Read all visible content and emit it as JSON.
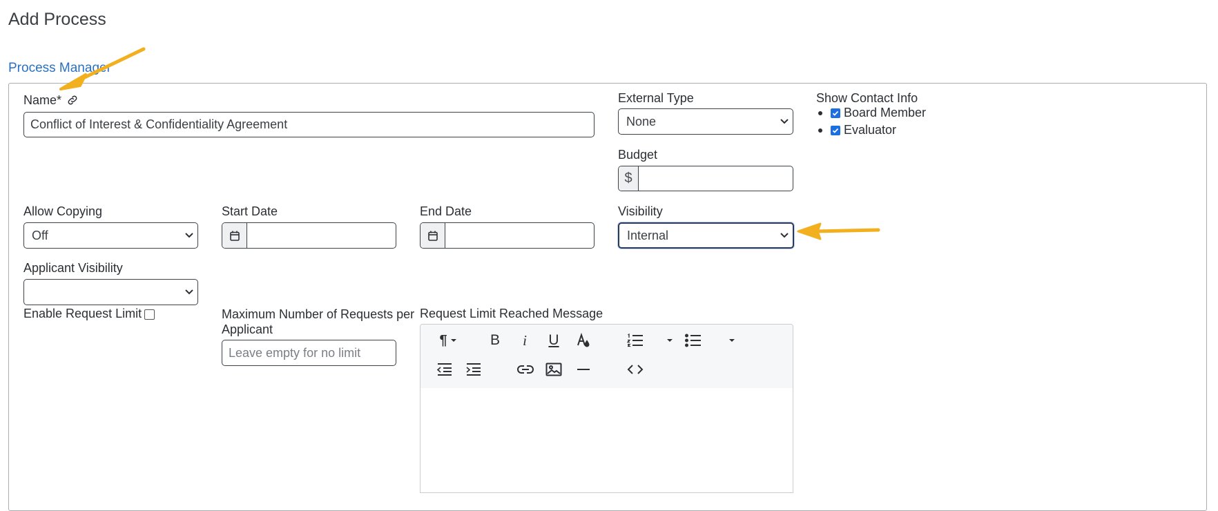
{
  "page": {
    "title": "Add Process"
  },
  "section": {
    "title": "Process Manager"
  },
  "form": {
    "name": {
      "label": "Name*",
      "value": "Conflict of Interest & Confidentiality Agreement"
    },
    "external_type": {
      "label": "External Type",
      "value": "None"
    },
    "contact": {
      "label": "Show Contact Info",
      "options": [
        {
          "label": "Board Member",
          "checked": true
        },
        {
          "label": "Evaluator",
          "checked": true
        }
      ]
    },
    "budget": {
      "label": "Budget",
      "prefix": "$",
      "value": ""
    },
    "allow_copying": {
      "label": "Allow Copying",
      "value": "Off"
    },
    "start_date": {
      "label": "Start Date",
      "value": ""
    },
    "end_date": {
      "label": "End Date",
      "value": ""
    },
    "visibility": {
      "label": "Visibility",
      "value": "Internal"
    },
    "applicant_visibility": {
      "label": "Applicant Visibility",
      "value": ""
    },
    "request_limit": {
      "label": "Enable Request Limit",
      "checked": false
    },
    "max_requests": {
      "label_line1": "Maximum Number of Requests per",
      "label_line2": "Applicant",
      "placeholder": "Leave empty for no limit"
    },
    "limit_message": {
      "label": "Request Limit Reached Message"
    }
  },
  "editor_toolbar": {
    "icons": [
      "paragraph-icon",
      "bold-icon",
      "italic-icon",
      "underline-icon",
      "text-color-icon",
      "ordered-list-icon",
      "unordered-list-icon",
      "outdent-icon",
      "indent-icon",
      "link-icon",
      "image-icon",
      "horizontal-rule-icon",
      "code-view-icon"
    ],
    "bold_glyph": "B",
    "italic_glyph": "i",
    "underline_glyph": "U",
    "paragraph_glyph": "¶"
  },
  "annotations": {
    "arrow_color": "#f2b01e"
  },
  "colors": {
    "link": "#2a70c2",
    "checkbox": "#1c6fe0",
    "focus_border": "#263b5e"
  }
}
